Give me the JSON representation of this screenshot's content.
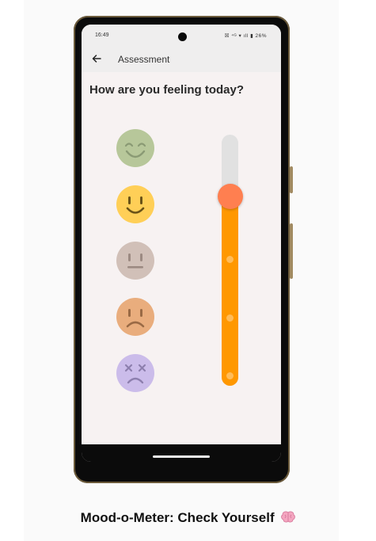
{
  "status_bar": {
    "time": "16:49",
    "icons_text": "☒ ⁴ᴳ ▾ ıll ▮ 26%",
    "battery": "26%"
  },
  "app_bar": {
    "back_icon": "arrow-left-icon",
    "title": "Assessment"
  },
  "main": {
    "question": "How are you feeling today?",
    "moods": [
      {
        "name": "very-happy",
        "color": "#b7c79a"
      },
      {
        "name": "happy",
        "color": "#ffcf57"
      },
      {
        "name": "neutral",
        "color": "#d1c0b8"
      },
      {
        "name": "sad",
        "color": "#e9ad7d"
      },
      {
        "name": "very-sad",
        "color": "#cbbcea"
      }
    ],
    "slider": {
      "selected_mood": "happy",
      "track_color": "#e1e1e1",
      "fill_color": "#ff9800",
      "thumb_color": "#ff7f50"
    }
  },
  "caption": {
    "text": "Mood-o-Meter: Check Yourself",
    "icon": "brain-icon"
  }
}
